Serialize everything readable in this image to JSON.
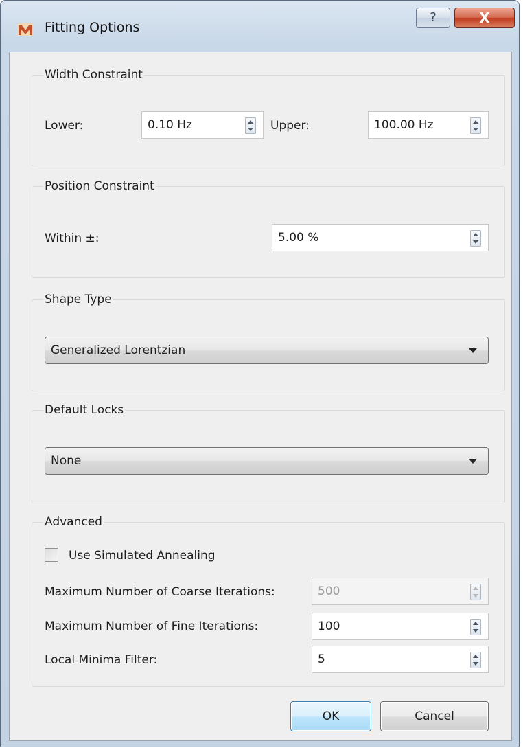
{
  "window": {
    "title": "Fitting Options",
    "help_label": "?",
    "close_label": "X"
  },
  "width_constraint": {
    "title": "Width Constraint",
    "lower_label": "Lower:",
    "lower_value": "0.10 Hz",
    "upper_label": "Upper:",
    "upper_value": "100.00 Hz"
  },
  "position_constraint": {
    "title": "Position Constraint",
    "within_label": "Within ±:",
    "within_value": "5.00 %"
  },
  "shape_type": {
    "title": "Shape Type",
    "selected": "Generalized Lorentzian"
  },
  "default_locks": {
    "title": "Default Locks",
    "selected": "None"
  },
  "advanced": {
    "title": "Advanced",
    "simulated_annealing_label": "Use Simulated Annealing",
    "simulated_annealing_checked": false,
    "coarse_label": "Maximum Number of Coarse Iterations:",
    "coarse_value": "500",
    "coarse_enabled": false,
    "fine_label": "Maximum Number of Fine Iterations:",
    "fine_value": "100",
    "minima_label": "Local Minima Filter:",
    "minima_value": "5"
  },
  "buttons": {
    "ok": "OK",
    "cancel": "Cancel"
  }
}
